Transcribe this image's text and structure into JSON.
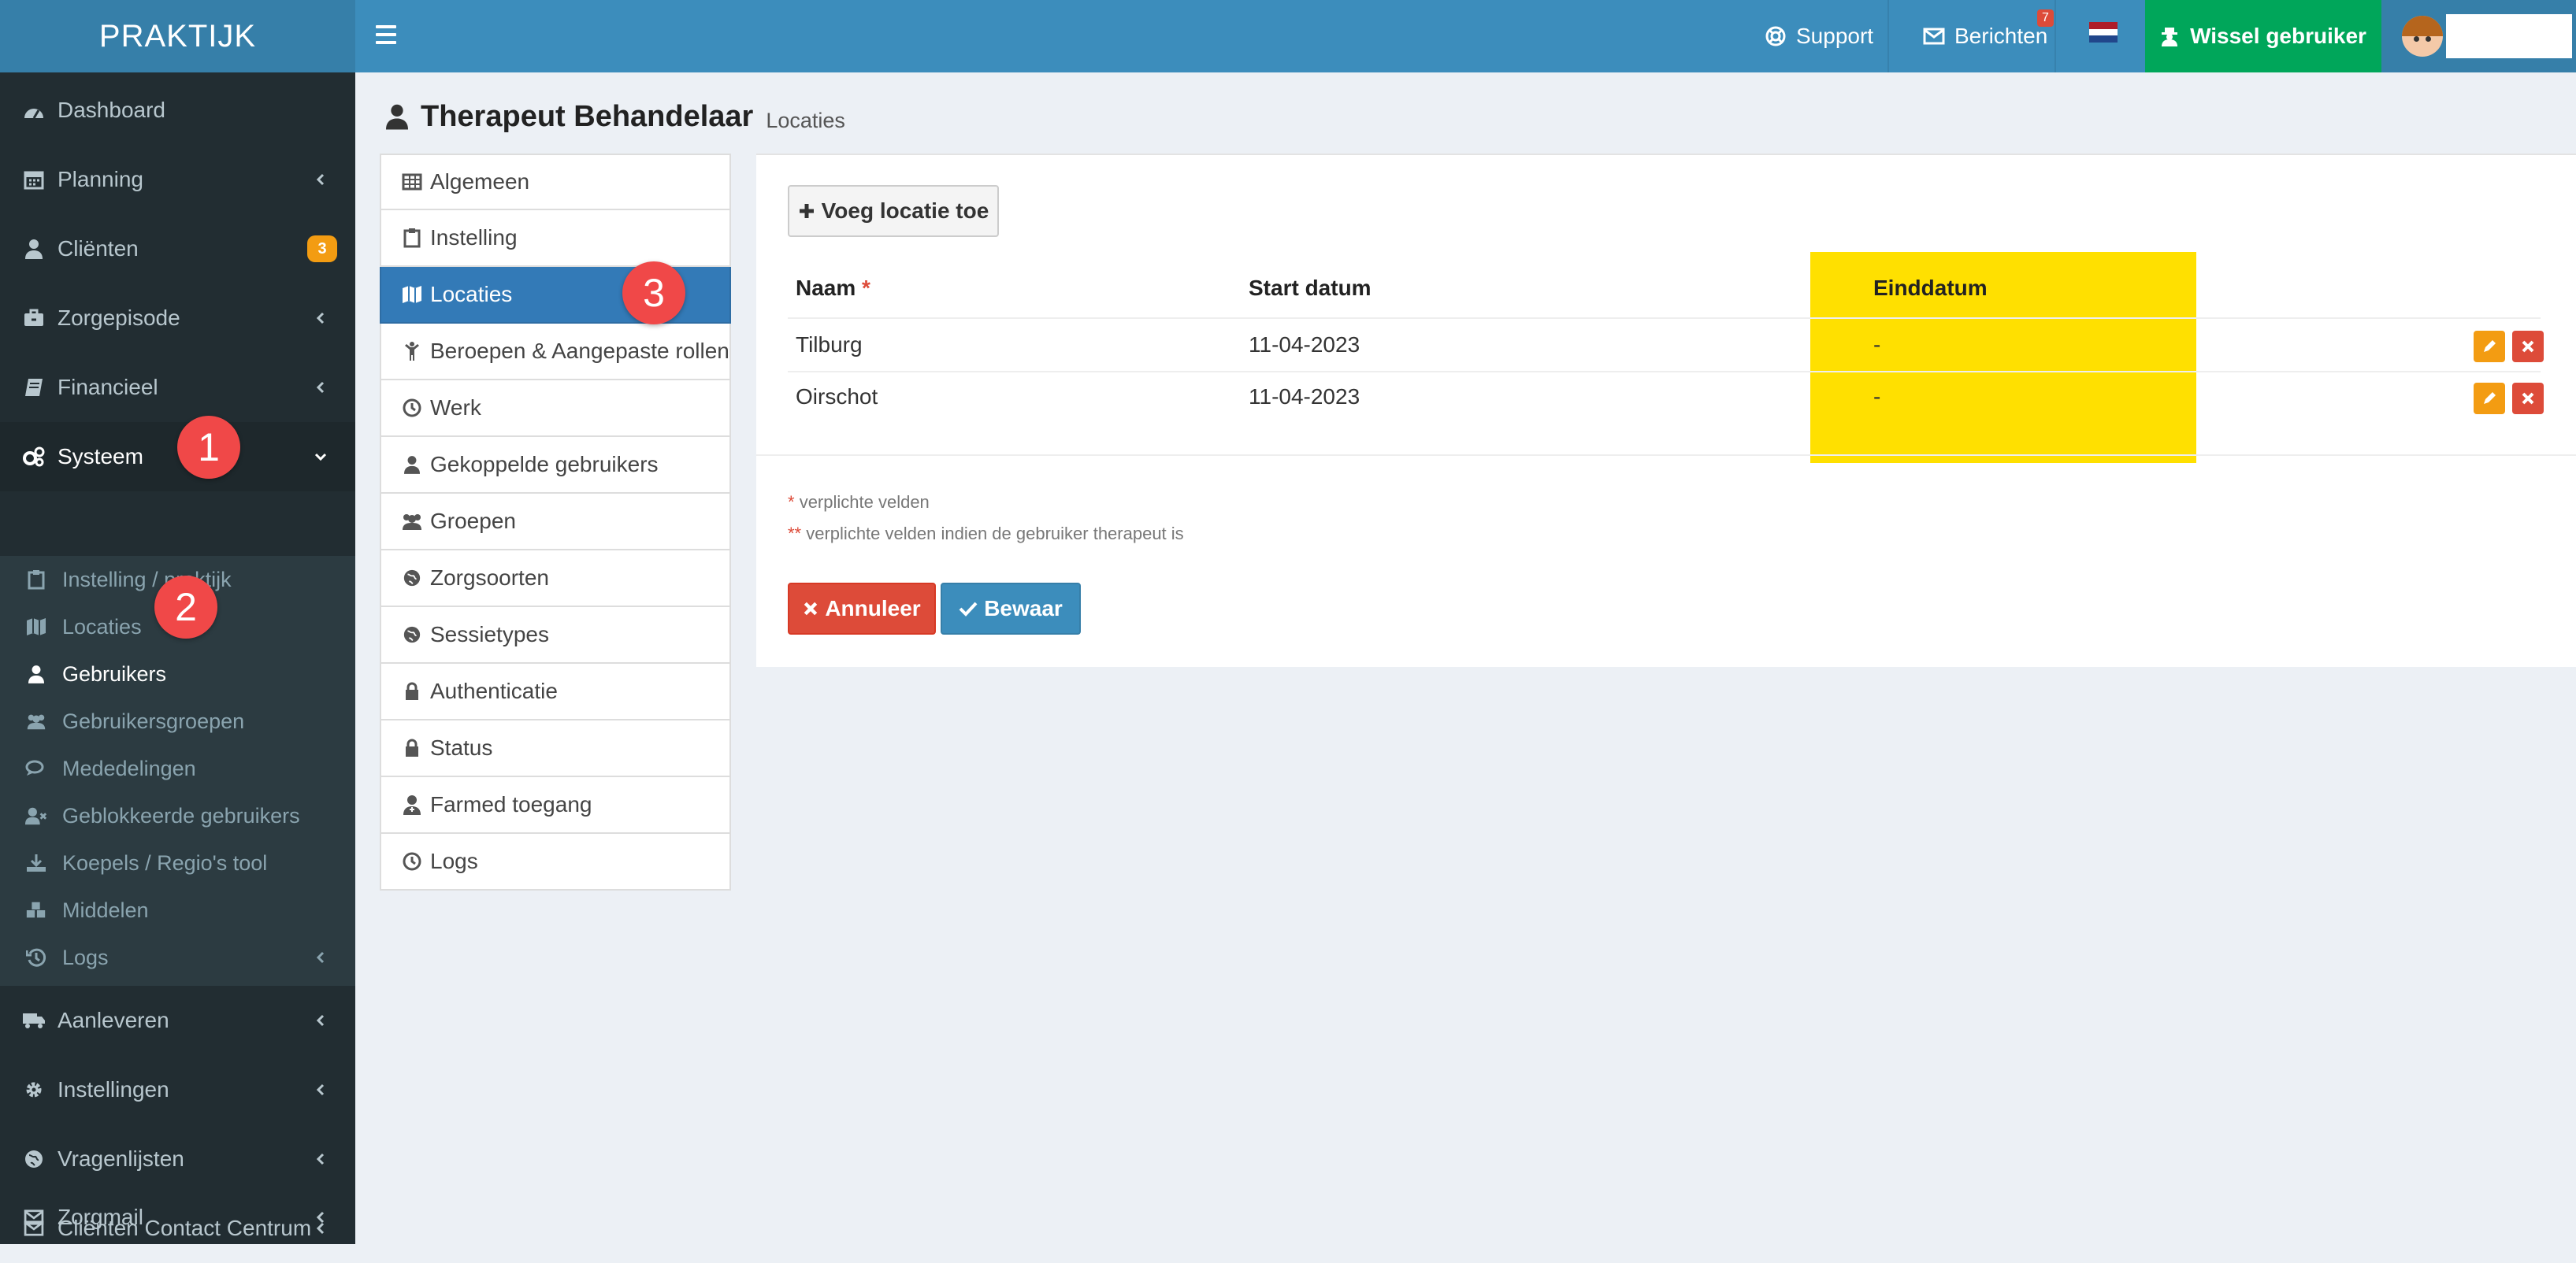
{
  "brand": "PRAKTIJK",
  "topnav": {
    "support": "Support",
    "messages": "Berichten",
    "messages_count": "7",
    "switch_user": "Wissel gebruiker",
    "flag_colors": [
      "#ae1c28",
      "#ffffff",
      "#21468b"
    ]
  },
  "sidebar": {
    "items": [
      {
        "label": "Dashboard",
        "icon": "dashboard-icon"
      },
      {
        "label": "Planning",
        "icon": "calendar-icon"
      },
      {
        "label": "Cliënten",
        "icon": "user-icon",
        "badge": "3"
      },
      {
        "label": "Zorgepisode",
        "icon": "briefcase-icon"
      },
      {
        "label": "Financieel",
        "icon": "book-icon"
      },
      {
        "label": "Systeem",
        "icon": "gears-icon"
      },
      {
        "label": "Aanleveren",
        "icon": "truck-icon"
      },
      {
        "label": "Instellingen",
        "icon": "gear-icon"
      },
      {
        "label": "Vragenlijsten",
        "icon": "globe-icon"
      },
      {
        "label": "Cliënten Contact Centrum",
        "icon": "envelope-icon"
      },
      {
        "label": "Zorgmail",
        "icon": "envelope-icon"
      }
    ],
    "sub_items": [
      {
        "label": "Instelling / praktijk",
        "icon": "clipboard-icon"
      },
      {
        "label": "Locaties",
        "icon": "map-icon"
      },
      {
        "label": "Gebruikers",
        "icon": "user-icon"
      },
      {
        "label": "Gebruikersgroepen",
        "icon": "users-icon"
      },
      {
        "label": "Mededelingen",
        "icon": "comments-icon"
      },
      {
        "label": "Geblokkeerde gebruikers",
        "icon": "user-times-icon"
      },
      {
        "label": "Koepels / Regio's tool",
        "icon": "download-icon"
      },
      {
        "label": "Middelen",
        "icon": "cubes-icon"
      },
      {
        "label": "Logs",
        "icon": "history-icon"
      }
    ]
  },
  "steps": [
    "1",
    "2",
    "3"
  ],
  "page": {
    "title": "Therapeut Behandelaar",
    "subtitle": "Locaties"
  },
  "tabs": [
    {
      "label": "Algemeen",
      "icon": "table-icon"
    },
    {
      "label": "Instelling",
      "icon": "clipboard-icon"
    },
    {
      "label": "Locaties",
      "icon": "map-icon"
    },
    {
      "label": "Beroepen & Aangepaste rollen",
      "icon": "child-icon"
    },
    {
      "label": "Werk",
      "icon": "clock-icon"
    },
    {
      "label": "Gekoppelde gebruikers",
      "icon": "user-icon"
    },
    {
      "label": "Groepen",
      "icon": "users-icon"
    },
    {
      "label": "Zorgsoorten",
      "icon": "globe-icon"
    },
    {
      "label": "Sessietypes",
      "icon": "globe-icon"
    },
    {
      "label": "Authenticatie",
      "icon": "lock-icon"
    },
    {
      "label": "Status",
      "icon": "lock-icon"
    },
    {
      "label": "Farmed toegang",
      "icon": "user-md-icon"
    },
    {
      "label": "Logs",
      "icon": "clock-icon"
    }
  ],
  "panel": {
    "add_button": "Voeg locatie toe",
    "columns": {
      "name": "Naam",
      "name_req": "*",
      "start": "Start datum",
      "end": "Einddatum"
    },
    "rows": [
      {
        "name": "Tilburg",
        "start": "11-04-2023",
        "end": "-"
      },
      {
        "name": "Oirschot",
        "start": "11-04-2023",
        "end": "-"
      }
    ],
    "note1_star": "*",
    "note1": "verplichte velden",
    "note2_star": "**",
    "note2": "verplichte velden indien de gebruiker therapeut is",
    "cancel": "Annuleer",
    "save": "Bewaar"
  }
}
